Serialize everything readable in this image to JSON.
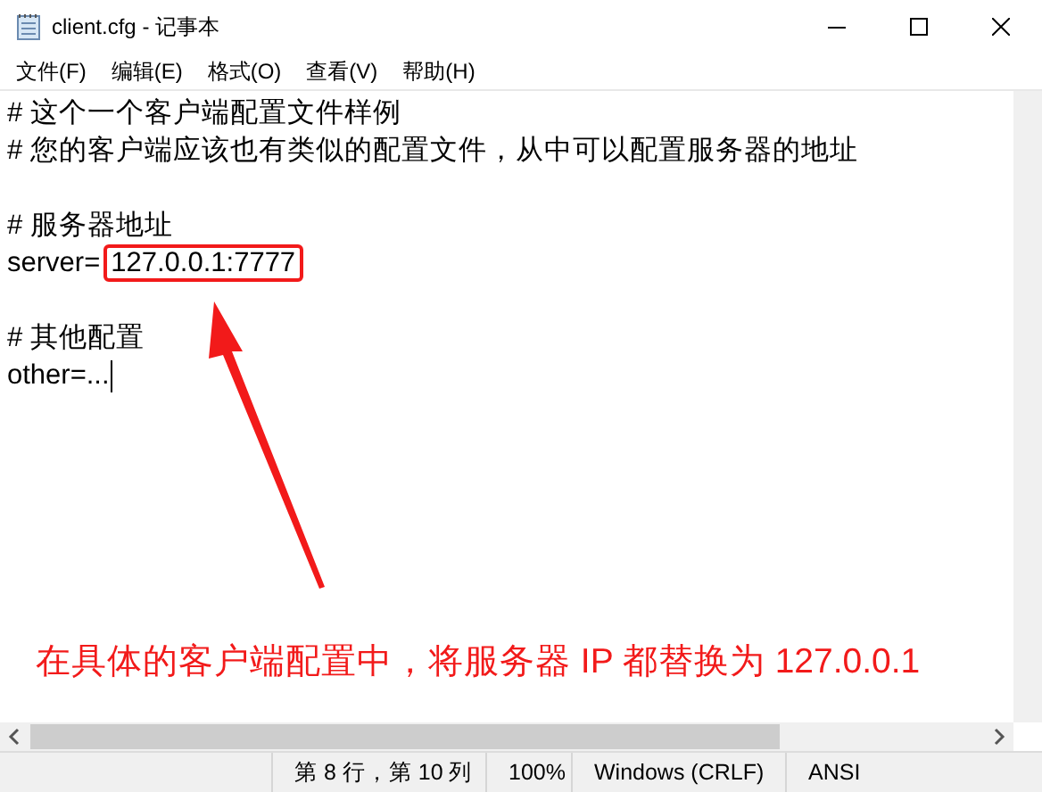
{
  "window": {
    "title": "client.cfg - 记事本"
  },
  "menu": [
    {
      "label": "文件(F)"
    },
    {
      "label": "编辑(E)"
    },
    {
      "label": "格式(O)"
    },
    {
      "label": "查看(V)"
    },
    {
      "label": "帮助(H)"
    }
  ],
  "editor": {
    "lines": [
      {
        "kind": "text",
        "text": "# 这个一个客户端配置文件样例",
        "caret": false
      },
      {
        "kind": "text",
        "text": "# 您的客户端应该也有类似的配置文件，从中可以配置服务器的地址",
        "caret": false
      },
      {
        "kind": "blank"
      },
      {
        "kind": "text",
        "text": "# 服务器地址",
        "caret": false
      },
      {
        "kind": "highlight",
        "key": "server=",
        "value": "127.0.0.1:7777"
      },
      {
        "kind": "blank"
      },
      {
        "kind": "text",
        "text": "# 其他配置",
        "caret": false
      },
      {
        "kind": "text",
        "text": "other=...",
        "caret": true
      }
    ]
  },
  "annotation": {
    "caption": "在具体的客户端配置中，将服务器 IP 都替换为 127.0.0.1"
  },
  "status_bar": [
    {
      "text": "第 8 行，第 10 列"
    },
    {
      "text": "100%"
    },
    {
      "text": "Windows (CRLF)"
    },
    {
      "text": "ANSI"
    }
  ]
}
